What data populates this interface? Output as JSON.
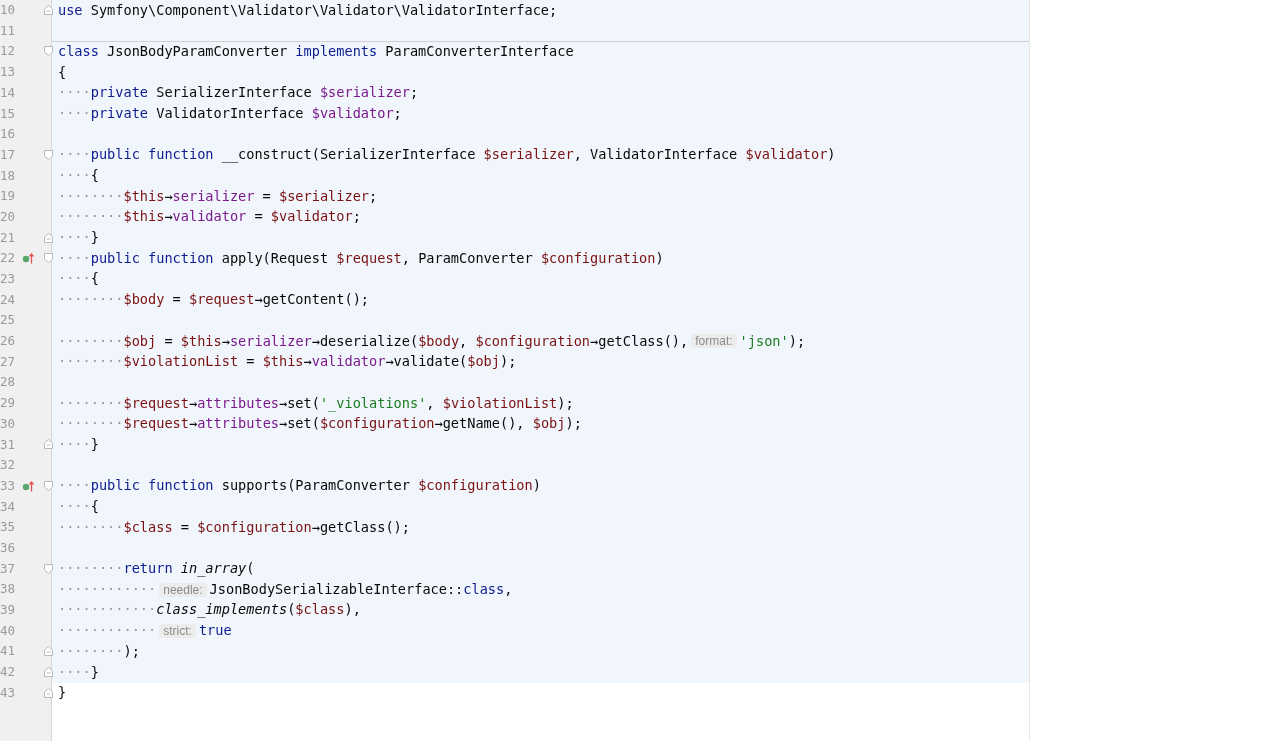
{
  "editor": {
    "lines": [
      {
        "number": "10",
        "fold_open": false,
        "fold_close": true,
        "implements_marker": false,
        "highlighted": true,
        "separator_above": false,
        "tokens": [
          {
            "kind": "keyword",
            "text": "use"
          },
          {
            "kind": "plain",
            "text": " Symfony\\Component\\Validator\\Validator\\ValidatorInterface;"
          }
        ]
      },
      {
        "number": "11",
        "fold_open": false,
        "fold_close": false,
        "highlighted": true,
        "implements_marker": false,
        "separator_above": false
      },
      {
        "number": "12",
        "fold_open": true,
        "fold_close": false,
        "implements_marker": false,
        "highlighted": true,
        "separator_above": true,
        "tokens": [
          {
            "kind": "keyword",
            "text": "class"
          },
          {
            "kind": "plain",
            "text": " JsonBodyParamConverter "
          },
          {
            "kind": "keyword",
            "text": "implements"
          },
          {
            "kind": "plain",
            "text": " ParamConverterInterface"
          }
        ]
      },
      {
        "number": "13",
        "fold_open": false,
        "fold_close": false,
        "highlighted": true,
        "implements_marker": false,
        "separator_above": false,
        "tokens": [
          {
            "kind": "plain",
            "text": "{"
          }
        ]
      },
      {
        "number": "14",
        "fold_open": false,
        "fold_close": false,
        "highlighted": true,
        "implements_marker": false,
        "separator_above": false,
        "tokens": [
          {
            "kind": "whitespace",
            "text": "····"
          },
          {
            "kind": "keyword",
            "text": "private"
          },
          {
            "kind": "plain",
            "text": " SerializerInterface "
          },
          {
            "kind": "property",
            "text": "$serializer"
          },
          {
            "kind": "plain",
            "text": ";"
          }
        ]
      },
      {
        "number": "15",
        "fold_open": false,
        "fold_close": false,
        "highlighted": true,
        "implements_marker": false,
        "separator_above": false,
        "tokens": [
          {
            "kind": "whitespace",
            "text": "····"
          },
          {
            "kind": "keyword",
            "text": "private"
          },
          {
            "kind": "plain",
            "text": " ValidatorInterface "
          },
          {
            "kind": "property",
            "text": "$validator"
          },
          {
            "kind": "plain",
            "text": ";"
          }
        ]
      },
      {
        "number": "16",
        "fold_open": false,
        "fold_close": false,
        "highlighted": true,
        "implements_marker": false,
        "separator_above": false
      },
      {
        "number": "17",
        "fold_open": true,
        "fold_close": false,
        "highlighted": true,
        "implements_marker": false,
        "separator_above": false,
        "tokens": [
          {
            "kind": "whitespace",
            "text": "····"
          },
          {
            "kind": "keyword",
            "text": "public function"
          },
          {
            "kind": "plain",
            "text": " __construct(SerializerInterface "
          },
          {
            "kind": "variable",
            "text": "$serializer"
          },
          {
            "kind": "plain",
            "text": ", ValidatorInterface "
          },
          {
            "kind": "variable",
            "text": "$validator"
          },
          {
            "kind": "plain",
            "text": ")"
          }
        ]
      },
      {
        "number": "18",
        "fold_open": false,
        "fold_close": false,
        "highlighted": true,
        "implements_marker": false,
        "separator_above": false,
        "tokens": [
          {
            "kind": "whitespace",
            "text": "····"
          },
          {
            "kind": "plain",
            "text": "{"
          }
        ]
      },
      {
        "number": "19",
        "fold_open": false,
        "fold_close": false,
        "highlighted": true,
        "implements_marker": false,
        "separator_above": false,
        "tokens": [
          {
            "kind": "whitespace",
            "text": "········"
          },
          {
            "kind": "variable",
            "text": "$this"
          },
          {
            "kind": "plain",
            "text": "→"
          },
          {
            "kind": "property",
            "text": "serializer"
          },
          {
            "kind": "plain",
            "text": " = "
          },
          {
            "kind": "variable",
            "text": "$serializer"
          },
          {
            "kind": "plain",
            "text": ";"
          }
        ]
      },
      {
        "number": "20",
        "fold_open": false,
        "fold_close": false,
        "highlighted": true,
        "implements_marker": false,
        "separator_above": false,
        "tokens": [
          {
            "kind": "whitespace",
            "text": "········"
          },
          {
            "kind": "variable",
            "text": "$this"
          },
          {
            "kind": "plain",
            "text": "→"
          },
          {
            "kind": "property",
            "text": "validator"
          },
          {
            "kind": "plain",
            "text": " = "
          },
          {
            "kind": "variable",
            "text": "$validator"
          },
          {
            "kind": "plain",
            "text": ";"
          }
        ]
      },
      {
        "number": "21",
        "fold_open": false,
        "fold_close": true,
        "highlighted": true,
        "implements_marker": false,
        "separator_above": false,
        "tokens": [
          {
            "kind": "whitespace",
            "text": "····"
          },
          {
            "kind": "plain",
            "text": "}"
          }
        ]
      },
      {
        "number": "22",
        "fold_open": true,
        "fold_close": false,
        "highlighted": true,
        "implements_marker": true,
        "separator_above": false,
        "tokens": [
          {
            "kind": "whitespace",
            "text": "····"
          },
          {
            "kind": "keyword",
            "text": "public function"
          },
          {
            "kind": "plain",
            "text": " apply(Request "
          },
          {
            "kind": "variable",
            "text": "$request"
          },
          {
            "kind": "plain",
            "text": ", ParamConverter "
          },
          {
            "kind": "variable",
            "text": "$configuration"
          },
          {
            "kind": "plain",
            "text": ")"
          }
        ]
      },
      {
        "number": "23",
        "fold_open": false,
        "fold_close": false,
        "highlighted": true,
        "implements_marker": false,
        "separator_above": false,
        "tokens": [
          {
            "kind": "whitespace",
            "text": "····"
          },
          {
            "kind": "plain",
            "text": "{"
          }
        ]
      },
      {
        "number": "24",
        "fold_open": false,
        "fold_close": false,
        "highlighted": true,
        "implements_marker": false,
        "separator_above": false,
        "tokens": [
          {
            "kind": "whitespace",
            "text": "········"
          },
          {
            "kind": "variable",
            "text": "$body"
          },
          {
            "kind": "plain",
            "text": " = "
          },
          {
            "kind": "variable",
            "text": "$request"
          },
          {
            "kind": "plain",
            "text": "→getContent();"
          }
        ]
      },
      {
        "number": "25",
        "fold_open": false,
        "fold_close": false,
        "highlighted": true,
        "implements_marker": false,
        "separator_above": false
      },
      {
        "number": "26",
        "fold_open": false,
        "fold_close": false,
        "highlighted": true,
        "implements_marker": false,
        "separator_above": false,
        "tokens": [
          {
            "kind": "whitespace",
            "text": "········"
          },
          {
            "kind": "variable",
            "text": "$obj"
          },
          {
            "kind": "plain",
            "text": " = "
          },
          {
            "kind": "variable",
            "text": "$this"
          },
          {
            "kind": "plain",
            "text": "→"
          },
          {
            "kind": "property",
            "text": "serializer"
          },
          {
            "kind": "plain",
            "text": "→deserialize("
          },
          {
            "kind": "variable",
            "text": "$body"
          },
          {
            "kind": "plain",
            "text": ", "
          },
          {
            "kind": "variable",
            "text": "$configuration"
          },
          {
            "kind": "plain",
            "text": "→getClass(),"
          },
          {
            "kind": "hint",
            "text": "format:"
          },
          {
            "kind": "string",
            "text": "'json'"
          },
          {
            "kind": "plain",
            "text": ");"
          }
        ]
      },
      {
        "number": "27",
        "fold_open": false,
        "fold_close": false,
        "highlighted": true,
        "implements_marker": false,
        "separator_above": false,
        "tokens": [
          {
            "kind": "whitespace",
            "text": "········"
          },
          {
            "kind": "variable",
            "text": "$violationList"
          },
          {
            "kind": "plain",
            "text": " = "
          },
          {
            "kind": "variable",
            "text": "$this"
          },
          {
            "kind": "plain",
            "text": "→"
          },
          {
            "kind": "property",
            "text": "validator"
          },
          {
            "kind": "plain",
            "text": "→validate("
          },
          {
            "kind": "variable",
            "text": "$obj"
          },
          {
            "kind": "plain",
            "text": ");"
          }
        ]
      },
      {
        "number": "28",
        "fold_open": false,
        "fold_close": false,
        "highlighted": true,
        "implements_marker": false,
        "separator_above": false
      },
      {
        "number": "29",
        "fold_open": false,
        "fold_close": false,
        "highlighted": true,
        "implements_marker": false,
        "separator_above": false,
        "tokens": [
          {
            "kind": "whitespace",
            "text": "········"
          },
          {
            "kind": "variable",
            "text": "$request"
          },
          {
            "kind": "plain",
            "text": "→"
          },
          {
            "kind": "property",
            "text": "attributes"
          },
          {
            "kind": "plain",
            "text": "→set("
          },
          {
            "kind": "string",
            "text": "'_violations'"
          },
          {
            "kind": "plain",
            "text": ", "
          },
          {
            "kind": "variable",
            "text": "$violationList"
          },
          {
            "kind": "plain",
            "text": ");"
          }
        ]
      },
      {
        "number": "30",
        "fold_open": false,
        "fold_close": false,
        "highlighted": true,
        "implements_marker": false,
        "separator_above": false,
        "tokens": [
          {
            "kind": "whitespace",
            "text": "········"
          },
          {
            "kind": "variable",
            "text": "$request"
          },
          {
            "kind": "plain",
            "text": "→"
          },
          {
            "kind": "property",
            "text": "attributes"
          },
          {
            "kind": "plain",
            "text": "→set("
          },
          {
            "kind": "variable",
            "text": "$configuration"
          },
          {
            "kind": "plain",
            "text": "→getName(), "
          },
          {
            "kind": "variable",
            "text": "$obj"
          },
          {
            "kind": "plain",
            "text": ");"
          }
        ]
      },
      {
        "number": "31",
        "fold_open": false,
        "fold_close": true,
        "highlighted": true,
        "implements_marker": false,
        "separator_above": false,
        "tokens": [
          {
            "kind": "whitespace",
            "text": "····"
          },
          {
            "kind": "plain",
            "text": "}"
          }
        ]
      },
      {
        "number": "32",
        "fold_open": false,
        "fold_close": false,
        "highlighted": true,
        "implements_marker": false,
        "separator_above": false
      },
      {
        "number": "33",
        "fold_open": true,
        "fold_close": false,
        "highlighted": true,
        "implements_marker": true,
        "separator_above": false,
        "tokens": [
          {
            "kind": "whitespace",
            "text": "····"
          },
          {
            "kind": "keyword",
            "text": "public function"
          },
          {
            "kind": "plain",
            "text": " supports(ParamConverter "
          },
          {
            "kind": "variable",
            "text": "$configuration"
          },
          {
            "kind": "plain",
            "text": ")"
          }
        ]
      },
      {
        "number": "34",
        "fold_open": false,
        "fold_close": false,
        "highlighted": true,
        "implements_marker": false,
        "separator_above": false,
        "tokens": [
          {
            "kind": "whitespace",
            "text": "····"
          },
          {
            "kind": "plain",
            "text": "{"
          }
        ]
      },
      {
        "number": "35",
        "fold_open": false,
        "fold_close": false,
        "highlighted": true,
        "implements_marker": false,
        "separator_above": false,
        "tokens": [
          {
            "kind": "whitespace",
            "text": "········"
          },
          {
            "kind": "variable",
            "text": "$class"
          },
          {
            "kind": "plain",
            "text": " = "
          },
          {
            "kind": "variable",
            "text": "$configuration"
          },
          {
            "kind": "plain",
            "text": "→getClass();"
          }
        ]
      },
      {
        "number": "36",
        "fold_open": false,
        "fold_close": false,
        "highlighted": true,
        "implements_marker": false,
        "separator_above": false
      },
      {
        "number": "37",
        "fold_open": true,
        "fold_close": false,
        "highlighted": true,
        "implements_marker": false,
        "separator_above": false,
        "tokens": [
          {
            "kind": "whitespace",
            "text": "········"
          },
          {
            "kind": "keyword",
            "text": "return "
          },
          {
            "kind": "function",
            "text": "in_array"
          },
          {
            "kind": "plain",
            "text": "("
          }
        ]
      },
      {
        "number": "38",
        "fold_open": false,
        "fold_close": false,
        "highlighted": true,
        "implements_marker": false,
        "separator_above": false,
        "tokens": [
          {
            "kind": "whitespace",
            "text": "············"
          },
          {
            "kind": "hint",
            "text": "needle:"
          },
          {
            "kind": "plain",
            "text": "JsonBodySerializableInterface::"
          },
          {
            "kind": "keyword",
            "text": "class"
          },
          {
            "kind": "plain",
            "text": ","
          }
        ]
      },
      {
        "number": "39",
        "fold_open": false,
        "fold_close": false,
        "highlighted": true,
        "implements_marker": false,
        "separator_above": false,
        "tokens": [
          {
            "kind": "whitespace",
            "text": "············"
          },
          {
            "kind": "function",
            "text": "class_implements"
          },
          {
            "kind": "plain",
            "text": "("
          },
          {
            "kind": "variable",
            "text": "$class"
          },
          {
            "kind": "plain",
            "text": "),"
          }
        ]
      },
      {
        "number": "40",
        "fold_open": false,
        "fold_close": false,
        "highlighted": true,
        "implements_marker": false,
        "separator_above": false,
        "tokens": [
          {
            "kind": "whitespace",
            "text": "············"
          },
          {
            "kind": "hint",
            "text": "strict:"
          },
          {
            "kind": "keyword",
            "text": "true"
          }
        ]
      },
      {
        "number": "41",
        "fold_open": false,
        "fold_close": true,
        "highlighted": true,
        "implements_marker": false,
        "separator_above": false,
        "tokens": [
          {
            "kind": "whitespace",
            "text": "········"
          },
          {
            "kind": "plain",
            "text": ");"
          }
        ]
      },
      {
        "number": "42",
        "fold_open": false,
        "fold_close": true,
        "highlighted": true,
        "implements_marker": false,
        "separator_above": false,
        "tokens": [
          {
            "kind": "whitespace",
            "text": "····"
          },
          {
            "kind": "plain",
            "text": "}"
          }
        ]
      },
      {
        "number": "43",
        "fold_open": false,
        "fold_close": true,
        "highlighted": false,
        "implements_marker": false,
        "separator_above": false,
        "tokens": [
          {
            "kind": "plain",
            "text": "}"
          }
        ]
      }
    ]
  }
}
